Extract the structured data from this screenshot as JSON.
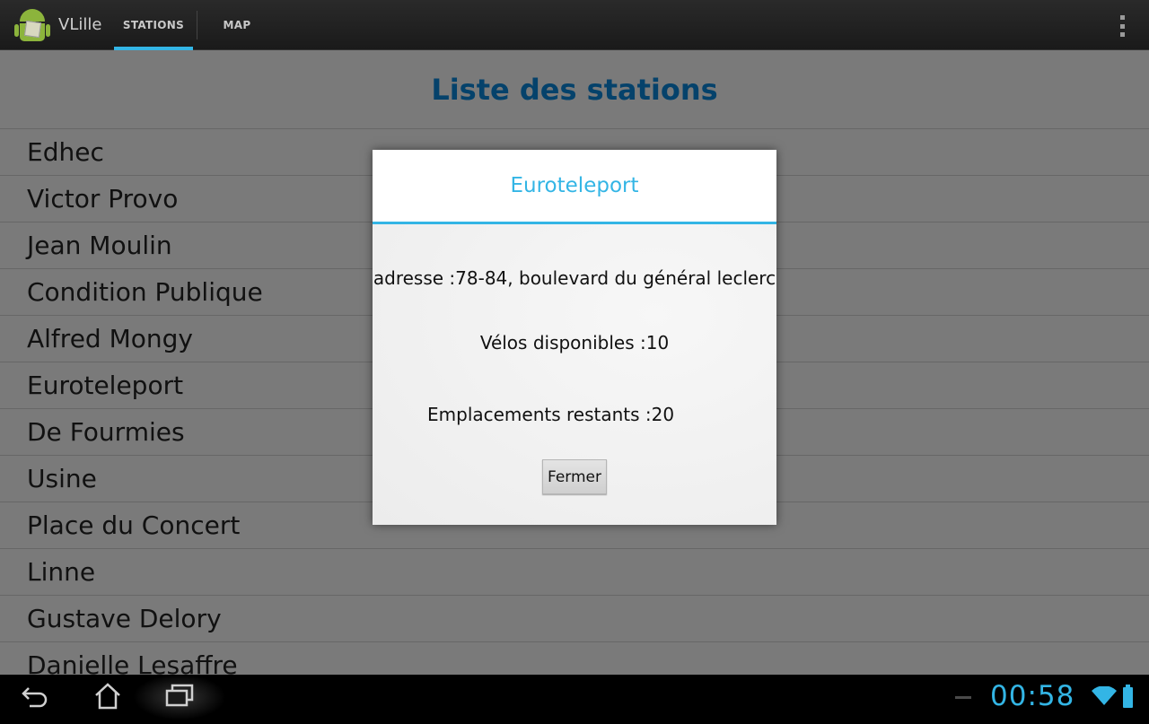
{
  "app": {
    "title": "VLille"
  },
  "tabs": [
    {
      "label": "STATIONS",
      "selected": true
    },
    {
      "label": "MAP",
      "selected": false
    }
  ],
  "list": {
    "title": "Liste des stations",
    "items": [
      "Edhec",
      "Victor Provo",
      "Jean Moulin",
      "Condition Publique",
      "Alfred Mongy",
      "Euroteleport",
      "De Fourmies",
      "Usine",
      "Place du Concert",
      "Linne",
      "Gustave Delory",
      "Danielle Lesaffre"
    ]
  },
  "dialog": {
    "title": "Euroteleport",
    "address": "adresse :78-84, boulevard du général leclerc",
    "bikes": "Vélos disponibles :10",
    "slots": "Emplacements restants :20",
    "close_label": "Fermer"
  },
  "status": {
    "time": "00:58"
  },
  "colors": {
    "accent": "#33b5e5",
    "title_blue": "#0a84d6",
    "android_green": "#8cb43c"
  },
  "icons": [
    "android-robot-icon",
    "overflow-menu-icon",
    "back-icon",
    "home-icon",
    "recent-apps-icon",
    "wifi-icon",
    "battery-icon"
  ]
}
